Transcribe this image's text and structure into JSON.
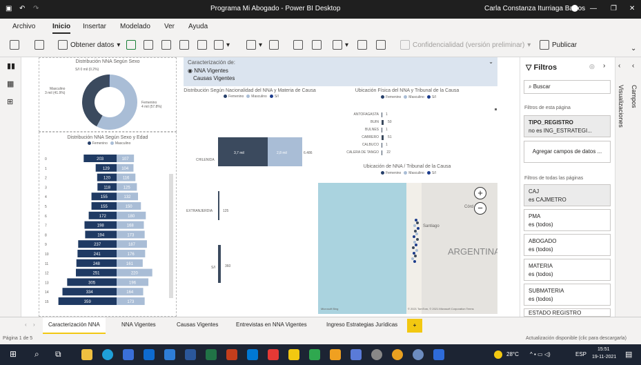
{
  "window": {
    "title": "Programa Mi Abogado - Power BI Desktop",
    "user": "Carla Constanza Iturriaga Barros"
  },
  "menus": [
    "Archivo",
    "Inicio",
    "Insertar",
    "Modelado",
    "Ver",
    "Ayuda"
  ],
  "ribbon": {
    "get_data": "Obtener datos",
    "sensitivity": "Confidencialidad (versión preliminar)",
    "publish": "Publicar"
  },
  "slicer": {
    "title": "Caracterización de:",
    "options": [
      "NNA Vigentes",
      "Causas Vigentes"
    ]
  },
  "donut": {
    "title": "Distribución NNA Según Sexo",
    "labels": {
      "sin": "S/I 0 mil (0.2%)",
      "masculino": "Masculino\n3 mil (41.9%)",
      "femenino": "Femenino\n4 mil (57.8%)"
    },
    "chart_data": {
      "type": "pie",
      "categories": [
        "Femenino",
        "Masculino",
        "S/I"
      ],
      "values": [
        57.8,
        41.9,
        0.2
      ]
    }
  },
  "pyramid": {
    "title": "Distribución NNA Según Sexo y Edad",
    "legend": [
      "Femenino",
      "Masculino"
    ],
    "chart_data": {
      "type": "bar",
      "categories": [
        "0",
        "1",
        "2",
        "3",
        "4",
        "5",
        "6",
        "7",
        "8",
        "9",
        "10",
        "11",
        "12",
        "13",
        "14",
        "15"
      ],
      "series": [
        {
          "name": "Femenino",
          "values": [
            203,
            129,
            120,
            118,
            155,
            155,
            172,
            198,
            194,
            237,
            241,
            248,
            251,
            305,
            334,
            359
          ]
        },
        {
          "name": "Masculino",
          "values": [
            107,
            104,
            116,
            125,
            132,
            150,
            180,
            168,
            173,
            187,
            176,
            161,
            220,
            196,
            164,
            173
          ]
        }
      ]
    }
  },
  "nacionalidad": {
    "title": "Distribución Según Nacionalidad del NNA y Materia de Causa",
    "legend": [
      "Femenino",
      "Masculino",
      "S/I"
    ],
    "chart_data": {
      "type": "bar",
      "categories": [
        "CHILENIDA",
        "EXTRANJERDIA",
        "S/I"
      ],
      "labels": [
        "3,7 mil",
        "2,8 mil",
        "6.486",
        "125",
        "360"
      ]
    }
  },
  "ubicacion": {
    "title": "Ubicación Física del NNA y Tribunal de la Causa",
    "legend": [
      "Femenino",
      "Masculino",
      "S/I"
    ],
    "chart_data": {
      "type": "bar",
      "categories": [
        "ANTOFAGASTA",
        "BUIN",
        "BULNES",
        "CABRERO",
        "CALBUCO",
        "CALERA DE TANGO"
      ],
      "values": [
        1,
        50,
        1,
        51,
        1,
        22
      ]
    }
  },
  "map": {
    "title": "Ubicación de NNA / Tribunal de la Causa",
    "legend": [
      "Femenino",
      "Masculino",
      "S/I"
    ],
    "labels": {
      "country": "ARGENTINA",
      "city": "Santiago",
      "cordoba": "Córd"
    },
    "attribution": "© 2021 TomTom, © 2021 Microsoft Corporation Terms",
    "bing": "Microsoft Bing"
  },
  "filters": {
    "title": "Filtros",
    "search": "Buscar",
    "page_header": "Filtros de esta página",
    "page_filter": {
      "name": "TIPO_REGISTRO",
      "value": "no es ING_ESTRATEGI..."
    },
    "add": "Agregar campos de datos ...",
    "all_header": "Filtros de todas las páginas",
    "all": [
      {
        "name": "CAJ",
        "value": "es CAJMETRO"
      },
      {
        "name": "PMA",
        "value": "es (todos)"
      },
      {
        "name": "ABOGADO",
        "value": "es (todos)"
      },
      {
        "name": "MATERIA",
        "value": "es (todos)"
      },
      {
        "name": "SUBMATERIA",
        "value": "es (todos)"
      },
      {
        "name": "ESTADO REGISTRO",
        "value": ""
      }
    ]
  },
  "panes": {
    "viz": "Visualizaciones",
    "fields": "Campos"
  },
  "tabs": [
    "Caracterización NNA",
    "NNA Vigentes",
    "Causas Vigentes",
    "Entrevistas en NNA Vigentes",
    "Ingreso Estrategias Jurídicas"
  ],
  "status": {
    "page": "Página 1 de 5",
    "update": "Actualización disponible (clic para descargarla)"
  },
  "taskbar": {
    "weather": "28°C",
    "lang": "ESP",
    "time": "15:51",
    "date": "19-11-2021"
  }
}
